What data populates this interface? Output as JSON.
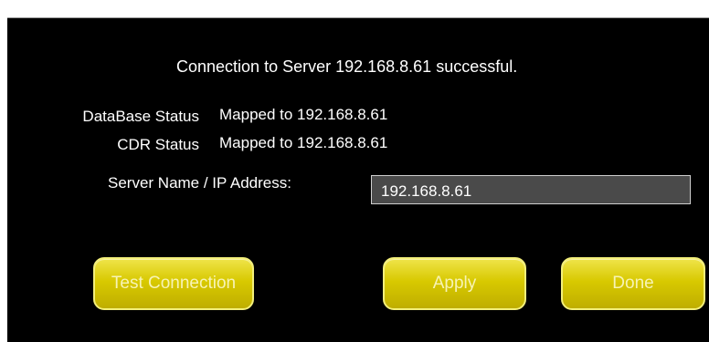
{
  "dialog": {
    "message": "Connection to Server 192.168.8.61 successful.",
    "database_status": {
      "label": "DataBase Status",
      "value": "Mapped to 192.168.8.61"
    },
    "cdr_status": {
      "label": "CDR Status",
      "value": "Mapped to 192.168.8.61"
    },
    "server_field": {
      "label": "Server Name / IP Address:",
      "value": "192.168.8.61"
    },
    "buttons": {
      "test_connection": "Test Connection",
      "apply": "Apply",
      "done": "Done"
    }
  },
  "colors": {
    "background": "#000000",
    "text": "#ffffff",
    "button_yellow": "#d8c900",
    "button_text": "#f7f3b5",
    "input_background": "#4a4a4a"
  }
}
